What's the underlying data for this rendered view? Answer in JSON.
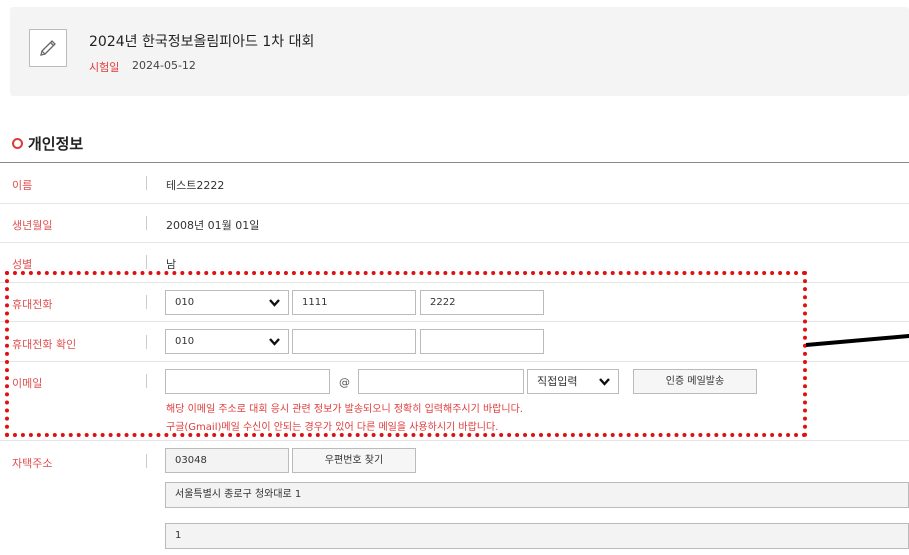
{
  "contest": {
    "title": "2024년 한국정보올림피아드 1차 대회",
    "date_label": "시험일",
    "date_value": "2024-05-12",
    "edit_icon": "pencil-icon"
  },
  "section": {
    "title": "개인정보",
    "bullet_icon": "circle-icon",
    "accent_color": "#e03a3a"
  },
  "rows": {
    "name": {
      "label": "이름",
      "value": "테스트2222"
    },
    "birth": {
      "label": "생년월일",
      "value": "2008년 01월 01일"
    },
    "gender": {
      "label": "성별",
      "value": "남"
    },
    "phone": {
      "label": "휴대전화",
      "prefix": "010",
      "middle": "1111",
      "last": "2222"
    },
    "phone_confirm": {
      "label": "휴대전화 확인",
      "prefix": "010",
      "middle": "",
      "last": ""
    },
    "email": {
      "label": "이메일",
      "local": "",
      "at": "@",
      "domain": "",
      "domain_select": "직접입력",
      "send_button": "인증 메일발송",
      "notice1": "해당 이메일 주소로 대회 응시 관련 정보가 발송되오니 정확히 입력해주시기 바랍니다.",
      "notice2": "구글(Gmail)메일 수신이 안되는 경우가 있어 다른 메일을 사용하시기 바랍니다."
    },
    "address": {
      "label": "자택주소",
      "postal": "03048",
      "search_button": "우편번호 찾기",
      "line1": "서울특별시 종로구 청와대로 1",
      "line2": "1"
    }
  },
  "annotation_color": "#e01010"
}
